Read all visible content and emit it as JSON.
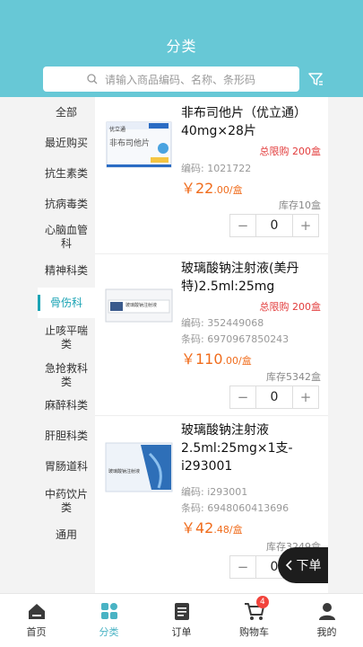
{
  "header": {
    "title": "分类"
  },
  "search": {
    "placeholder": "请输入商品编码、名称、条形码"
  },
  "sidebar": {
    "items": [
      {
        "label": "全部"
      },
      {
        "label": "最近购买"
      },
      {
        "label": "抗生素类"
      },
      {
        "label": "抗病毒类"
      },
      {
        "label": "心脑血管科"
      },
      {
        "label": "精神科类"
      },
      {
        "label": "骨伤科"
      },
      {
        "label": "止咳平喘类"
      },
      {
        "label": "急抢救科类"
      },
      {
        "label": "麻醉科类"
      },
      {
        "label": "肝胆科类"
      },
      {
        "label": "胃肠道科"
      },
      {
        "label": "中药饮片类"
      },
      {
        "label": "通用"
      }
    ],
    "active_index": 6
  },
  "products": [
    {
      "name": "非布司他片（优立通）40mg×28片",
      "limit": "总限购 200盒",
      "code": "编码: 1021722",
      "barcode": "",
      "price_main": "￥22",
      "price_decimal": ".00/盒",
      "stock": "库存10盒",
      "qty": "0",
      "box_text": "非布司他片",
      "box_brand": "优立通"
    },
    {
      "name": "玻璃酸钠注射液(美丹特)2.5ml:25mg",
      "limit": "总限购 200盒",
      "code": "编码: 352449068",
      "barcode": "条码: 6970967850243",
      "price_main": "￥110",
      "price_decimal": ".00/盒",
      "stock": "库存5342盒",
      "qty": "0",
      "box_text": "玻璃酸钠注射液"
    },
    {
      "name": "玻璃酸钠注射液2.5ml:25mg×1支-i293001",
      "limit": "",
      "code": "编码: i293001",
      "barcode": "条码: 6948060413696",
      "price_main": "￥42",
      "price_decimal": ".48/盒",
      "stock": "库存3249盒",
      "qty": "0",
      "box_text": "玻璃酸钠注射液"
    }
  ],
  "stepper": {
    "minus": "−",
    "plus": "+"
  },
  "fab": {
    "label": "下单",
    "icon": "chevron-left-icon"
  },
  "tabbar": {
    "items": [
      {
        "label": "首页",
        "icon": "home-icon"
      },
      {
        "label": "分类",
        "icon": "category-icon"
      },
      {
        "label": "订单",
        "icon": "order-icon"
      },
      {
        "label": "购物车",
        "icon": "cart-icon"
      },
      {
        "label": "我的",
        "icon": "user-icon"
      }
    ],
    "active_index": 1,
    "cart_badge": "4"
  },
  "colors": {
    "accent": "#67c8d6",
    "active": "#1aa3b4",
    "price": "#f06c1c",
    "limit": "#e23b3b"
  }
}
